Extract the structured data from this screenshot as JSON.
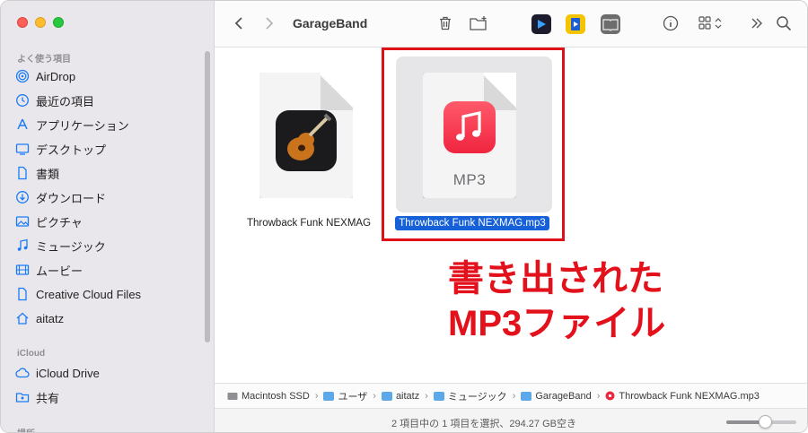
{
  "window": {
    "title": "GarageBand"
  },
  "sidebar": {
    "favorites_title": "よく使う項目",
    "favorites": [
      {
        "label": "AirDrop",
        "icon": "airdrop-icon"
      },
      {
        "label": "最近の項目",
        "icon": "clock-icon"
      },
      {
        "label": "アプリケーション",
        "icon": "applications-icon"
      },
      {
        "label": "デスクトップ",
        "icon": "desktop-icon"
      },
      {
        "label": "書類",
        "icon": "document-icon"
      },
      {
        "label": "ダウンロード",
        "icon": "download-icon"
      },
      {
        "label": "ピクチャ",
        "icon": "pictures-icon"
      },
      {
        "label": "ミュージック",
        "icon": "music-note-icon"
      },
      {
        "label": "ムービー",
        "icon": "film-icon"
      },
      {
        "label": "Creative Cloud Files",
        "icon": "document-icon"
      },
      {
        "label": "aitatz",
        "icon": "home-icon"
      }
    ],
    "icloud_title": "iCloud",
    "icloud": [
      {
        "label": "iCloud Drive",
        "icon": "cloud-icon"
      },
      {
        "label": "共有",
        "icon": "shared-folder-icon"
      }
    ],
    "locations_title": "場所"
  },
  "files": [
    {
      "name": "Throwback Funk NEXMAG",
      "selected": false,
      "kind": "garageband-project"
    },
    {
      "name": "Throwback Funk NEXMAG.mp3",
      "selected": true,
      "kind": "mp3",
      "badge": "MP3"
    }
  ],
  "annotation": {
    "line1": "書き出された",
    "line2": "MP3ファイル",
    "color": "#e2111b"
  },
  "pathbar": [
    {
      "label": "Macintosh SSD"
    },
    {
      "label": "ユーザ"
    },
    {
      "label": "aitatz"
    },
    {
      "label": "ミュージック"
    },
    {
      "label": "GarageBand"
    },
    {
      "label": "Throwback Funk NEXMAG.mp3"
    }
  ],
  "status": {
    "text": "2 項目中の 1 項目を選択、294.27 GB空き",
    "zoom_fraction": 0.55
  },
  "colors": {
    "selection": "#1660d8",
    "accent": "#1a7cf5"
  }
}
